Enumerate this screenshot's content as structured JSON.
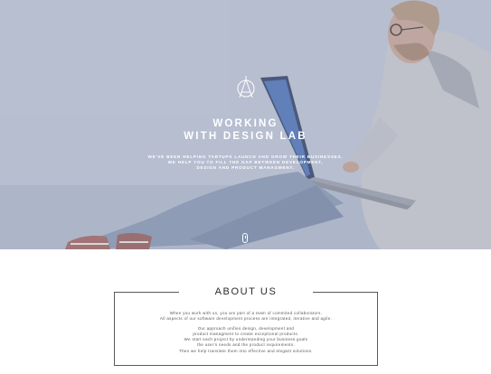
{
  "hero": {
    "title_line1": "WORKING",
    "title_line2": "WITH DESIGN LAB",
    "subtitle_line1": "WE'VE BEEN HELPING TARTUPS LAUNCH AND GROW THEIR BUSINESSES.",
    "subtitle_line2": "WE HELP YOU TO FILL THE GAP BETWEEN DEVELOPMENT,",
    "subtitle_line3": "DESIGN AND PRODUCT MANAGMENT.",
    "logo_icon": "design-lab-logo-icon",
    "scroll_icon": "mouse-scroll-icon"
  },
  "about": {
    "title": "ABOUT US",
    "p1_line1": "When you work with us, you are part of a team of commited collaborators.",
    "p1_line2": "All aspects of our software development process are integrated, iterative and agile.",
    "p2_line1": "Our approach unifies design, development and",
    "p2_line2": "product managment to create exceptional products.",
    "p2_line3": "We start each project by understanding your business goals",
    "p2_line4": "the user's needs and the product requirements.",
    "p2_line5": "Then we help translate them into effective and elegant solutions."
  },
  "colors": {
    "hero_tint": "#b7bed0",
    "text_light": "#ffffff",
    "about_title": "#2b2b2b",
    "about_text": "#555555",
    "border": "#5a5a5a"
  }
}
